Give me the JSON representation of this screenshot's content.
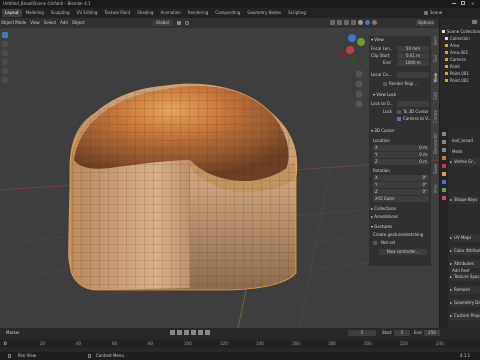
{
  "window_title": "Untitled_Bread\\Scene (Unfold) - Blender 4.1",
  "menus": [
    "File",
    "Edit",
    "Render",
    "Window",
    "Help"
  ],
  "workspaces": [
    "Layout",
    "Modeling",
    "Sculpting",
    "UV Editing",
    "Texture Paint",
    "Shading",
    "Animation",
    "Rendering",
    "Compositing",
    "Geometry Nodes",
    "Scripting"
  ],
  "scene_label": "Scene",
  "view_layer": "ViewLayer",
  "header": {
    "mode": "Object Mode",
    "view": "View",
    "select": "Select",
    "add": "Add",
    "object": "Object",
    "transform": "Global",
    "options": "Options"
  },
  "npanel": {
    "view_title": "View",
    "focal_length_label": "Focal Len...",
    "focal_length": "50 mm",
    "clip_start_label": "Clip Start",
    "clip_start": "0.01 m",
    "clip_end_label": "End",
    "clip_end": "1000 m",
    "local_camera_label": "Local Ca...",
    "render_region": "Render Regi...",
    "view_lock_title": "View Lock",
    "lock_to_object": "Lock to O...",
    "lock_label": "Lock",
    "to_3d_cursor": "To 3D Cursor",
    "camera_to_view": "Camera to V...",
    "cursor_title": "3D Cursor",
    "location_label": "Location",
    "rotation_label": "Rotation",
    "axis_x": "X",
    "axis_y": "Y",
    "axis_z": "Z",
    "loc_x": "0 m",
    "loc_y": "0 m",
    "loc_z": "0 m",
    "rot_x": "0°",
    "rot_y": "0°",
    "rot_z": "0°",
    "rotation_mode": "XYZ Euler",
    "collections_title": "Collections",
    "annotations_title": "Annotations",
    "gestures_title": "Gestures",
    "gestures_text": "Create gesture/sketching",
    "not_set": "Not set",
    "new_controller": "New controller...",
    "side_tabs": [
      "Item",
      "Tool",
      "View",
      "Edit",
      "Create",
      "BlenderKit",
      "Bake",
      "Misc"
    ]
  },
  "outliner": {
    "items": [
      "Scene Collection",
      "Collection",
      "Area",
      "Area.001",
      "Camera",
      "Point",
      "Point.001",
      "Point.002"
    ]
  },
  "properties": {
    "object_name": "loaf_bread",
    "mesh_label": "Mesh",
    "panels": [
      "Vertex Gr...",
      "Shape Keys",
      "UV Maps",
      "Color Attributes",
      "Attributes",
      "Texture Space",
      "Remesh",
      "Geometry Data",
      "Custom Properties"
    ],
    "add_rest": "Add Rest",
    "mask_label": "Mask"
  },
  "timeline": {
    "label": "Marker",
    "frame": "1",
    "start": "Start",
    "start_val": "1",
    "end": "End",
    "end_val": "250"
  },
  "ruler": [
    "0",
    "20",
    "40",
    "60",
    "80",
    "100",
    "120",
    "140",
    "160",
    "180",
    "200",
    "220",
    "240"
  ],
  "status": {
    "left": "Pan View",
    "middle": "Context Menu",
    "version": "4.1.1"
  }
}
